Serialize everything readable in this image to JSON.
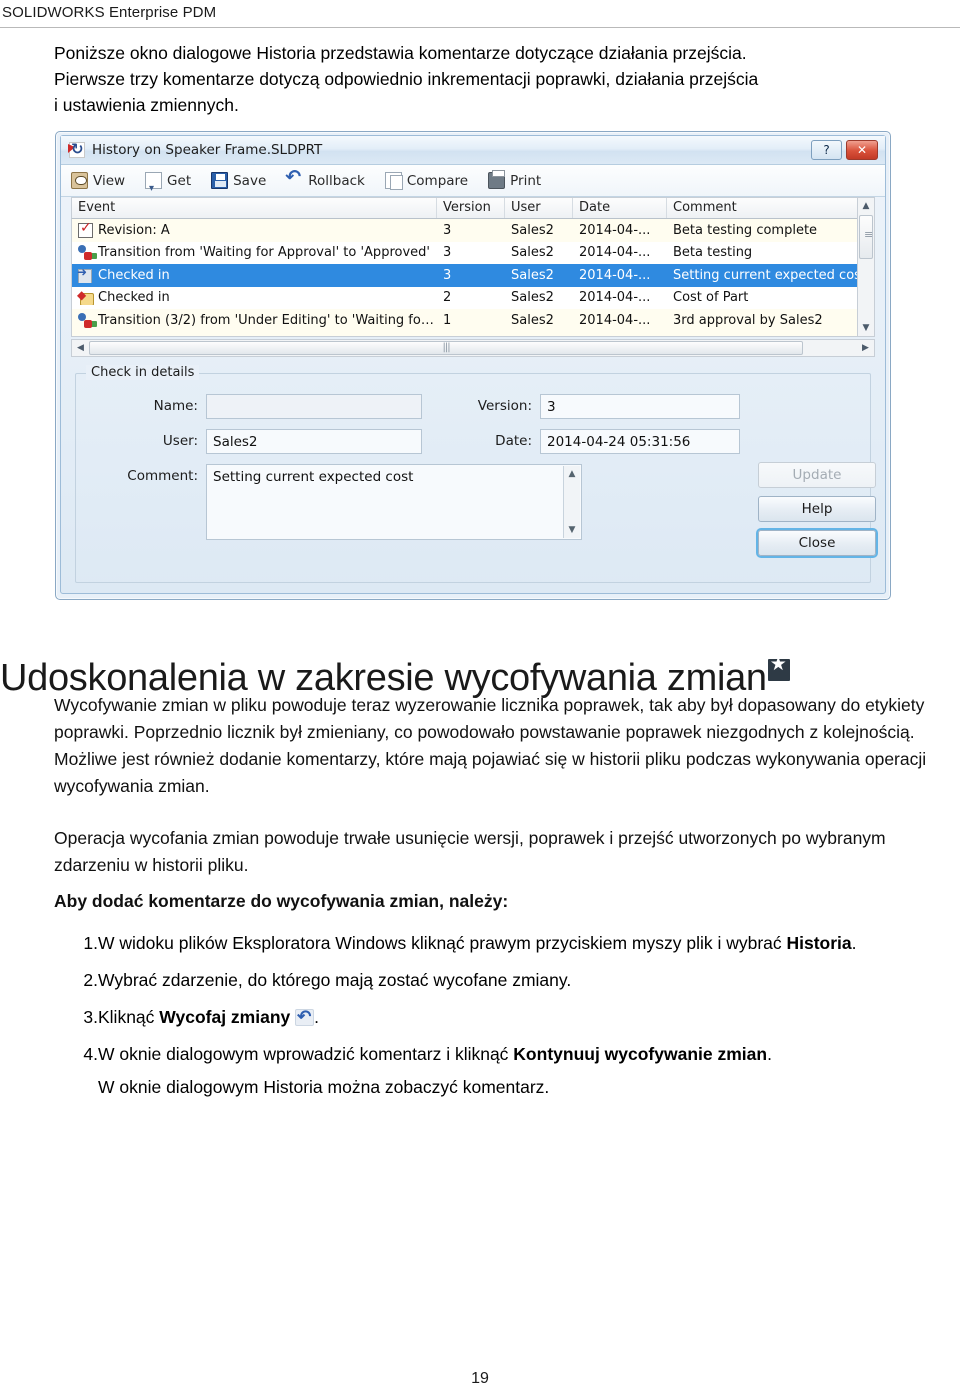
{
  "header": {
    "running_head": "SOLIDWORKS Enterprise PDM"
  },
  "intro": {
    "line1": "Poniższe okno dialogowe Historia przedstawia komentarze dotyczące działania przejścia.",
    "line2": "Pierwsze trzy komentarze dotyczą odpowiednio inkrementacji poprawki, działania przejścia",
    "line3": "i ustawienia zmiennych."
  },
  "screenshot": {
    "title": "History on Speaker Frame.SLDPRT",
    "title_icon": "history-rollback-icon",
    "window_buttons": {
      "help": "?",
      "close": "✕"
    },
    "toolbar": [
      {
        "label": "View",
        "icon": "view-icon"
      },
      {
        "label": "Get",
        "icon": "get-icon"
      },
      {
        "label": "Save",
        "icon": "save-icon"
      },
      {
        "label": "Rollback",
        "icon": "rollback-icon"
      },
      {
        "label": "Compare",
        "icon": "compare-icon"
      },
      {
        "label": "Print",
        "icon": "print-icon"
      }
    ],
    "columns": [
      "Event",
      "Version",
      "User",
      "Date",
      "Comment"
    ],
    "rows": [
      {
        "icon": "revision-icon",
        "event": "Revision: A",
        "version": "3",
        "user": "Sales2",
        "date": "2014-04-...",
        "comment": "Beta testing complete",
        "selected": false
      },
      {
        "icon": "transition-icon",
        "event": "Transition from 'Waiting for Approval' to 'Approved'",
        "version": "3",
        "user": "Sales2",
        "date": "2014-04-...",
        "comment": "Beta testing",
        "selected": false
      },
      {
        "icon": "checked-in-blue-icon",
        "event": "Checked in",
        "version": "3",
        "user": "Sales2",
        "date": "2014-04-...",
        "comment": "Setting current expected cost",
        "selected": true
      },
      {
        "icon": "checked-in-yellow-icon",
        "event": "Checked in",
        "version": "2",
        "user": "Sales2",
        "date": "2014-04-...",
        "comment": "Cost of Part",
        "selected": false
      },
      {
        "icon": "transition-icon",
        "event": "Transition (3/2) from 'Under Editing' to 'Waiting fo…",
        "version": "1",
        "user": "Sales2",
        "date": "2014-04-...",
        "comment": "3rd approval by Sales2",
        "selected": false
      }
    ],
    "details": {
      "group_label": "Check in details",
      "name_label": "Name:",
      "name_value": "",
      "user_label": "User:",
      "user_value": "Sales2",
      "comment_label": "Comment:",
      "comment_value": "Setting current expected cost",
      "version_label": "Version:",
      "version_value": "3",
      "date_label": "Date:",
      "date_value": "2014-04-24 05:31:56"
    },
    "buttons": {
      "update": "Update",
      "help": "Help",
      "close": "Close"
    },
    "colors": {
      "selection": "#2f8ae0",
      "list_background": "#fffdf0",
      "dialog_background": "#e8f0f8",
      "close_button": "#d9513a"
    }
  },
  "section": {
    "heading": "Udoskonalenia w zakresie wycofywania zmian",
    "heading_badge": "new-feature-star-icon",
    "para1": "Wycofywanie zmian w pliku powoduje teraz wyzerowanie licznika poprawek, tak aby był dopasowany do etykiety poprawki. Poprzednio licznik był zmieniany, co powodowało powstawanie poprawek niezgodnych z kolejnością. Możliwe jest również dodanie komentarzy, które mają pojawiać się w historii pliku podczas wykonywania operacji wycofywania zmian.",
    "para2": "Operacja wycofania zmian powoduje trwałe usunięcie wersji, poprawek i przejść utworzonych po wybranym zdarzeniu w historii pliku.",
    "procedure_intro": "Aby dodać komentarze do wycofywania zmian, należy:",
    "steps": [
      {
        "num": "1.",
        "pre": "W widoku plików Eksploratora Windows kliknąć prawym przyciskiem myszy plik i wybrać ",
        "bold": "Historia",
        "post": "."
      },
      {
        "num": "2.",
        "pre": "Wybrać zdarzenie, do którego mają zostać wycofane zmiany.",
        "bold": "",
        "post": ""
      },
      {
        "num": "3.",
        "pre": "Kliknąć ",
        "bold": "Wycofaj zmiany",
        "post": ".",
        "icon": "rollback-icon"
      },
      {
        "num": "4.",
        "pre": "W oknie dialogowym wprowadzić komentarz i kliknąć ",
        "bold": "Kontynuuj wycofywanie zmian",
        "post": ".",
        "extra": "W oknie dialogowym Historia można zobaczyć komentarz."
      }
    ]
  },
  "footer": {
    "page_number": "19"
  }
}
